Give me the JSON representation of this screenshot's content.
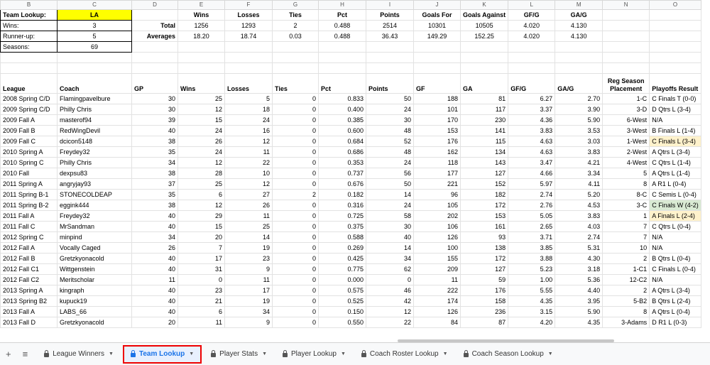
{
  "columns": [
    "B",
    "C",
    "D",
    "E",
    "F",
    "G",
    "H",
    "I",
    "J",
    "K",
    "L",
    "M",
    "N",
    "O"
  ],
  "summary": {
    "team_lookup_label": "Team Lookup:",
    "team_value": "LA",
    "wins_label": "Wins:",
    "wins_value": "3",
    "runnerup_label": "Runner-up:",
    "runnerup_value": "5",
    "seasons_label": "Seasons:",
    "seasons_value": "69",
    "headers": [
      "Wins",
      "Losses",
      "Ties",
      "Pct",
      "Points",
      "Goals For",
      "Goals Against",
      "GF/G",
      "GA/G"
    ],
    "total_label": "Total",
    "total": [
      "1256",
      "1293",
      "2",
      "0.488",
      "2514",
      "10301",
      "10505",
      "4.020",
      "4.130"
    ],
    "averages_label": "Averages",
    "averages": [
      "18.20",
      "18.74",
      "0.03",
      "0.488",
      "36.43",
      "149.29",
      "152.25",
      "4.020",
      "4.130"
    ]
  },
  "table": {
    "headers": [
      "League",
      "Coach",
      "GP",
      "Wins",
      "Losses",
      "Ties",
      "Pct",
      "Points",
      "GF",
      "GA",
      "GF/G",
      "GA/G",
      "Reg Season Placement",
      "Playoffs Result"
    ],
    "rows": [
      [
        "2008 Spring C/D",
        "Flamingpavelbure",
        "30",
        "25",
        "5",
        "0",
        "0.833",
        "50",
        "188",
        "81",
        "6.27",
        "2.70",
        "1-C",
        "C Finals T (0-0)"
      ],
      [
        "2009 Spring C/D",
        "Philly Chris",
        "30",
        "12",
        "18",
        "0",
        "0.400",
        "24",
        "101",
        "117",
        "3.37",
        "3.90",
        "3-D",
        "D Qtrs L (3-4)"
      ],
      [
        "2009 Fall A",
        "masterof94",
        "39",
        "15",
        "24",
        "0",
        "0.385",
        "30",
        "170",
        "230",
        "4.36",
        "5.90",
        "6-West",
        "N/A"
      ],
      [
        "2009 Fall B",
        "RedWingDevil",
        "40",
        "24",
        "16",
        "0",
        "0.600",
        "48",
        "153",
        "141",
        "3.83",
        "3.53",
        "3-West",
        "B Finals L (1-4)"
      ],
      [
        "2009 Fall C",
        "dcicon5148",
        "38",
        "26",
        "12",
        "0",
        "0.684",
        "52",
        "176",
        "115",
        "4.63",
        "3.03",
        "1-West",
        "C Finals L (3-4)"
      ],
      [
        "2010 Spring A",
        "Freydey32",
        "35",
        "24",
        "11",
        "0",
        "0.686",
        "48",
        "162",
        "134",
        "4.63",
        "3.83",
        "2-West",
        "A Qtrs L (3-4)"
      ],
      [
        "2010 Spring C",
        "Philly Chris",
        "34",
        "12",
        "22",
        "0",
        "0.353",
        "24",
        "118",
        "143",
        "3.47",
        "4.21",
        "4-West",
        "C Qtrs L (1-4)"
      ],
      [
        "2010 Fall",
        "dexpsu83",
        "38",
        "28",
        "10",
        "0",
        "0.737",
        "56",
        "177",
        "127",
        "4.66",
        "3.34",
        "5",
        "A Qtrs L (1-4)"
      ],
      [
        "2011 Spring A",
        "angryjay93",
        "37",
        "25",
        "12",
        "0",
        "0.676",
        "50",
        "221",
        "152",
        "5.97",
        "4.11",
        "8",
        "A R1 L (0-4)"
      ],
      [
        "2011 Spring B-1",
        "STONECOLDEAP",
        "35",
        "6",
        "27",
        "2",
        "0.182",
        "14",
        "96",
        "182",
        "2.74",
        "5.20",
        "8-C",
        "C Semis L (0-4)"
      ],
      [
        "2011 Spring B-2",
        "eggink444",
        "38",
        "12",
        "26",
        "0",
        "0.316",
        "24",
        "105",
        "172",
        "2.76",
        "4.53",
        "3-C",
        "C Finals W (4-2)"
      ],
      [
        "2011 Fall A",
        "Freydey32",
        "40",
        "29",
        "11",
        "0",
        "0.725",
        "58",
        "202",
        "153",
        "5.05",
        "3.83",
        "1",
        "A Finals L (2-4)"
      ],
      [
        "2011 Fall C",
        "MrSandman",
        "40",
        "15",
        "25",
        "0",
        "0.375",
        "30",
        "106",
        "161",
        "2.65",
        "4.03",
        "7",
        "C Qtrs L (0-4)"
      ],
      [
        "2012 Spring C",
        "minpind",
        "34",
        "20",
        "14",
        "0",
        "0.588",
        "40",
        "126",
        "93",
        "3.71",
        "2.74",
        "7",
        "N/A"
      ],
      [
        "2012 Fall A",
        "Vocally Caged",
        "26",
        "7",
        "19",
        "0",
        "0.269",
        "14",
        "100",
        "138",
        "3.85",
        "5.31",
        "10",
        "N/A"
      ],
      [
        "2012 Fall B",
        "Gretzkyonacold",
        "40",
        "17",
        "23",
        "0",
        "0.425",
        "34",
        "155",
        "172",
        "3.88",
        "4.30",
        "2",
        "B Qtrs L (0-4)"
      ],
      [
        "2012 Fall C1",
        "Wittgenstein",
        "40",
        "31",
        "9",
        "0",
        "0.775",
        "62",
        "209",
        "127",
        "5.23",
        "3.18",
        "1-C1",
        "C Finals L (0-4)"
      ],
      [
        "2012 Fall C2",
        "Meritscholar",
        "11",
        "0",
        "11",
        "0",
        "0.000",
        "0",
        "11",
        "59",
        "1.00",
        "5.36",
        "12-C2",
        "N/A"
      ],
      [
        "2013 Spring A",
        "kingraph",
        "40",
        "23",
        "17",
        "0",
        "0.575",
        "46",
        "222",
        "176",
        "5.55",
        "4.40",
        "2",
        "A Qtrs L (3-4)"
      ],
      [
        "2013 Spring B2",
        "kupuck19",
        "40",
        "21",
        "19",
        "0",
        "0.525",
        "42",
        "174",
        "158",
        "4.35",
        "3.95",
        "5-B2",
        "B Qtrs L (2-4)"
      ],
      [
        "2013 Fall A",
        "LABS_66",
        "40",
        "6",
        "34",
        "0",
        "0.150",
        "12",
        "126",
        "236",
        "3.15",
        "5.90",
        "8",
        "A Qtrs L (0-4)"
      ],
      [
        "2013 Fall D",
        "Gretzkyonacold",
        "20",
        "11",
        "9",
        "0",
        "0.550",
        "22",
        "84",
        "87",
        "4.20",
        "4.35",
        "3-Adams",
        "D R1 L (0-3)"
      ]
    ]
  },
  "highlights": {
    "yellow_rows": [
      4,
      11
    ],
    "green_rows": [
      10
    ],
    "team_cell_color": "#ffff00",
    "highlight_yellow": "#fff2cc",
    "highlight_green": "#d9ead3"
  },
  "tabs": {
    "add_icon": "+",
    "menu_icon": "≡",
    "items": [
      {
        "label": "League Winners",
        "icon": "lock-icon",
        "active": false
      },
      {
        "label": "Team Lookup",
        "icon": "lock-icon",
        "active": true
      },
      {
        "label": "Player Stats",
        "icon": "lock-icon",
        "active": false
      },
      {
        "label": "Player Lookup",
        "icon": "lock-icon",
        "active": false
      },
      {
        "label": "Coach Roster Lookup",
        "icon": "lock-icon",
        "active": false
      },
      {
        "label": "Coach Season Lookup",
        "icon": "lock-icon",
        "active": false
      }
    ],
    "active_border_color": "#e00000"
  }
}
